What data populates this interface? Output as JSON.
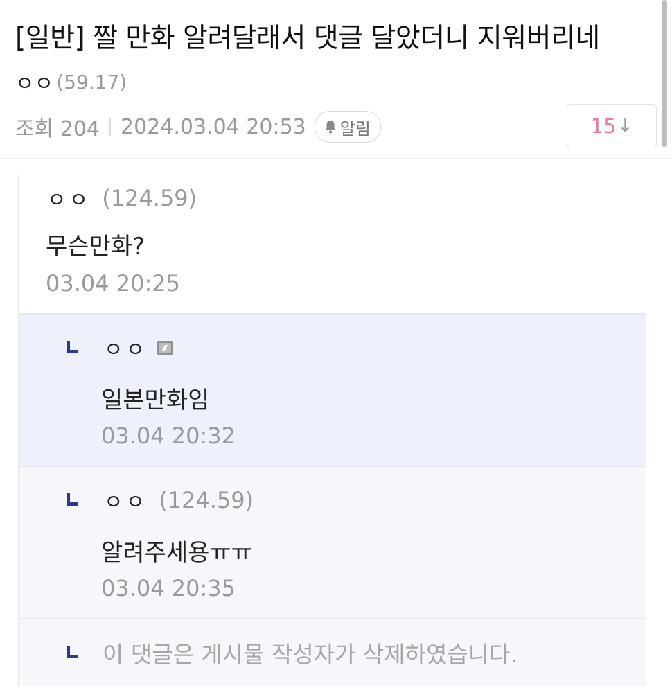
{
  "post": {
    "title": "[일반] 짤 만화 알려달래서 댓글 달았더니 지워버리네",
    "author": "ㅇㅇ",
    "author_ip": "(59.17)",
    "views_label": "조회 204",
    "datetime": "2024.03.04 20:53",
    "notify_label": "알림",
    "comment_count": "15",
    "sort_arrow": "↓"
  },
  "comments": [
    {
      "author": "ㅇㅇ",
      "ip": "(124.59)",
      "body": "무슨만화?",
      "time": "03.04 20:25"
    },
    {
      "author": "ㅇㅇ",
      "ip": "",
      "body": "일본만화임",
      "time": "03.04 20:32",
      "badge_icon": "fixed-nickname-icon"
    },
    {
      "author": "ㅇㅇ",
      "ip": "(124.59)",
      "body": "알려주세용ㅠㅠ",
      "time": "03.04 20:35"
    },
    {
      "deleted_text": "이 댓글은 게시물 작성자가 삭제하였습니다."
    }
  ],
  "colors": {
    "count_accent": "#e87ca7",
    "reply_arrow": "#2b3a8f",
    "highlight_bg": "#eef1fb",
    "reply_bg": "#f6f7fb"
  }
}
